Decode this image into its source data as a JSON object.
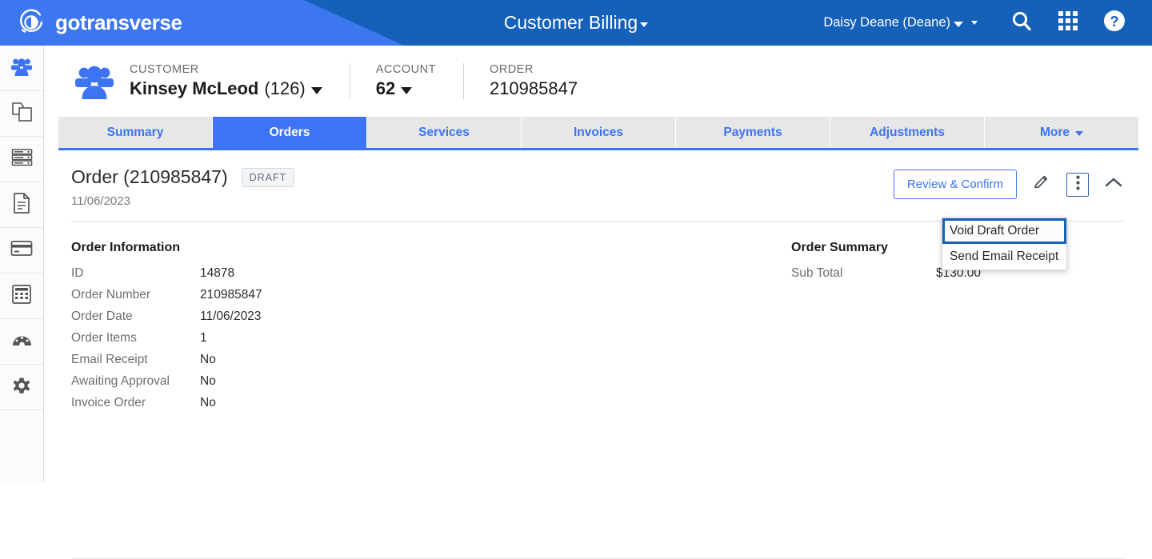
{
  "header": {
    "brand": "gotransverse",
    "brand_icon": "gotransverse-circle-logo",
    "app_title": "Customer Billing",
    "app_title_caret_icon": "chevron-down-icon",
    "user_name": "Daisy Deane (Deane)",
    "user_caret_icon": "chevron-down-icon",
    "extra_caret_icon": "chevron-down-small-icon",
    "search_icon": "search-icon",
    "apps_icon": "apps-grid-icon",
    "help_icon": "help-circle-icon",
    "bg_color": "#1560b8",
    "wedge_color": "#3d77f0"
  },
  "sidebar": {
    "items": [
      {
        "icon": "customers-people-icon",
        "label": "Customers",
        "active": true
      },
      {
        "icon": "products-copy-icon",
        "label": "Products",
        "active": false
      },
      {
        "icon": "server-database-icon",
        "label": "Billing",
        "active": false
      },
      {
        "icon": "document-file-icon",
        "label": "Documents",
        "active": false
      },
      {
        "icon": "credit-card-icon",
        "label": "Payments",
        "active": false
      },
      {
        "icon": "calculator-icon",
        "label": "Calculations",
        "active": false
      },
      {
        "icon": "speedometer-dashboard-icon",
        "label": "Dashboard",
        "active": false
      },
      {
        "icon": "gear-settings-icon",
        "label": "Settings",
        "active": false
      }
    ]
  },
  "breadcrumb": {
    "icon": "customer-group-icon",
    "customer": {
      "label": "CUSTOMER",
      "name": "Kinsey McLeod",
      "id": "(126)"
    },
    "account": {
      "label": "ACCOUNT",
      "value": "62"
    },
    "order": {
      "label": "ORDER",
      "value": "210985847"
    }
  },
  "tabs": {
    "items": [
      {
        "label": "Summary",
        "active": false
      },
      {
        "label": "Orders",
        "active": true
      },
      {
        "label": "Services",
        "active": false
      },
      {
        "label": "Invoices",
        "active": false
      },
      {
        "label": "Payments",
        "active": false
      },
      {
        "label": "Adjustments",
        "active": false
      },
      {
        "label": "More",
        "active": false,
        "has_caret": true
      }
    ],
    "active_color": "#3d74f3"
  },
  "order": {
    "title": "Order (210985847)",
    "status_badge": "DRAFT",
    "date": "11/06/2023",
    "review_button": "Review & Confirm",
    "edit_icon": "pencil-edit-icon",
    "more_icon": "kebab-vertical-dots-icon",
    "collapse_icon": "chevron-up-icon"
  },
  "order_information": {
    "title": "Order Information",
    "rows": [
      {
        "key": "ID",
        "value": "14878"
      },
      {
        "key": "Order Number",
        "value": "210985847"
      },
      {
        "key": "Order Date",
        "value": "11/06/2023"
      },
      {
        "key": "Order Items",
        "value": "1"
      },
      {
        "key": "Email Receipt",
        "value": "No"
      },
      {
        "key": "Awaiting Approval",
        "value": "No"
      },
      {
        "key": "Invoice Order",
        "value": "No"
      }
    ]
  },
  "order_summary": {
    "title": "Order Summary",
    "rows": [
      {
        "key": "Sub Total",
        "value": "$130.00"
      }
    ]
  },
  "dropdown_menu": {
    "items": [
      {
        "label": "Void Draft Order",
        "focused": true
      },
      {
        "label": "Send Email Receipt",
        "focused": false
      }
    ],
    "focus_color": "#1560b8"
  }
}
